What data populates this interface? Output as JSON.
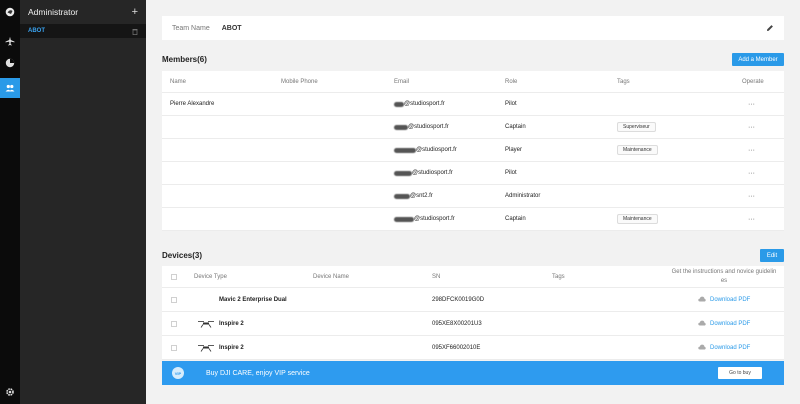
{
  "sidebar": {
    "title": "Administrator",
    "add_icon": "plus-icon",
    "team_item": "ABOT",
    "rail_icons": [
      "logo-icon",
      "airplane-icon",
      "pie-chart-icon",
      "team-icon",
      "settings-icon"
    ]
  },
  "team": {
    "label": "Team Name",
    "value": "ABOT"
  },
  "members": {
    "title": "Members(6)",
    "add_button": "Add a Member",
    "columns": [
      "Name",
      "Mobile Phone",
      "Email",
      "Role",
      "Tags",
      "Operate"
    ],
    "rows": [
      {
        "name": "Pierre Alexandre",
        "phone": "",
        "email": "@studiosport.fr",
        "role": "Pilot",
        "tag": "",
        "operate": "···"
      },
      {
        "name": "",
        "phone": "",
        "email": "@studiosport.fr",
        "role": "Captain",
        "tag": "Superviseur",
        "operate": "···"
      },
      {
        "name": "",
        "phone": "",
        "email": "@studiosport.fr",
        "role": "Player",
        "tag": "Maintenance",
        "operate": "···"
      },
      {
        "name": "",
        "phone": "",
        "email": "@studiosport.fr",
        "role": "Pilot",
        "tag": "",
        "operate": "···"
      },
      {
        "name": "",
        "phone": "",
        "email": "@snt2.fr",
        "role": "Administrator",
        "tag": "",
        "operate": "···"
      },
      {
        "name": "",
        "phone": "",
        "email": "@studiosport.fr",
        "role": "Captain",
        "tag": "Maintenance",
        "operate": "···"
      }
    ]
  },
  "devices": {
    "title": "Devices(3)",
    "edit_button": "Edit",
    "columns": [
      "Device Type",
      "Device Name",
      "SN",
      "Tags",
      "Get the instructions and novice guidelin es"
    ],
    "rows": [
      {
        "type": "Mavic 2 Enterprise Dual",
        "name": "",
        "sn": "298DFCK0019G0D",
        "tags": "",
        "download": "Download PDF"
      },
      {
        "type": "Inspire 2",
        "name": "",
        "sn": "095XE8X00201U3",
        "tags": "",
        "download": "Download PDF"
      },
      {
        "type": "Inspire 2",
        "name": "",
        "sn": "095XF66002010E",
        "tags": "",
        "download": "Download PDF"
      }
    ]
  },
  "banner": {
    "text": "Buy DJI CARE, enjoy VIP service",
    "button": "Go to buy",
    "badge": "VIP"
  },
  "colors": {
    "accent": "#2a9ae8",
    "rail": "#0b0b0b",
    "panel": "#262626"
  }
}
